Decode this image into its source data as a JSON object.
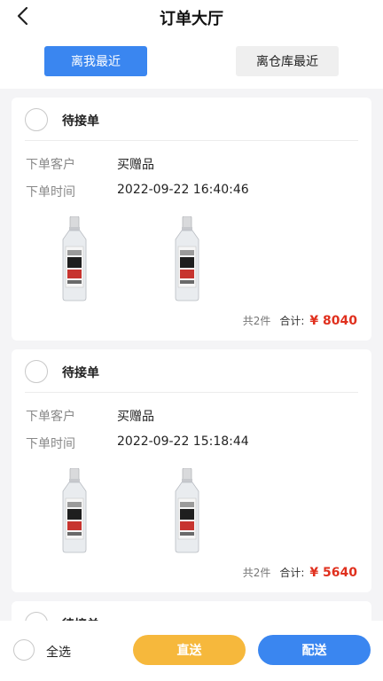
{
  "header": {
    "title": "订单大厅",
    "sort_near_me": "离我最近",
    "sort_near_warehouse": "离仓库最近"
  },
  "labels": {
    "customer": "下单客户",
    "time": "下单时间",
    "total": "合计:"
  },
  "orders": [
    {
      "status": "待接单",
      "customer": "买赠品",
      "time": "2022-09-22 16:40:46",
      "count": "共2件",
      "price": "¥ 8040"
    },
    {
      "status": "待接单",
      "customer": "买赠品",
      "time": "2022-09-22 15:18:44",
      "count": "共2件",
      "price": "¥ 5640"
    },
    {
      "status": "待接单"
    }
  ],
  "footer": {
    "select_all": "全选",
    "direct_label": "直送",
    "deliver_label": "配送"
  },
  "colors": {
    "primary_blue": "#3a86f0",
    "accent_orange": "#f6b83c",
    "price_red": "#e0301e"
  }
}
